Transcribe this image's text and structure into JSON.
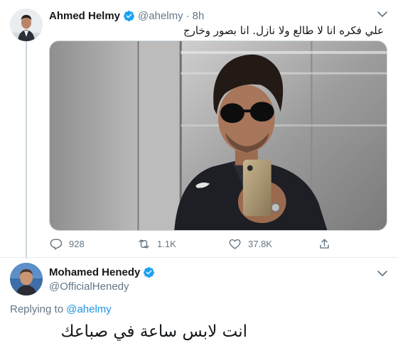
{
  "original_tweet": {
    "author": {
      "display_name": "Ahmed Helmy",
      "handle": "@ahelmy",
      "verified": true
    },
    "separator": "·",
    "time": "8h",
    "text": "علي فكره انا لا طالع ولا نازل. انا بصور وخارج",
    "media": {
      "description_icon": "elevator-selfie-photo"
    },
    "actions": {
      "reply_count": "928",
      "retweet_count": "1.1K",
      "like_count": "37.8K"
    }
  },
  "reply_tweet": {
    "author": {
      "display_name": "Mohamed Henedy",
      "handle": "@OfficialHenedy",
      "verified": true
    },
    "replying_to_label": "Replying to",
    "replying_to_handle": "@ahelmy",
    "text": "انت لابس ساعة في صباعك"
  },
  "colors": {
    "verified_blue": "#1da1f2",
    "secondary_text": "#657786",
    "link_blue": "#1b95e0",
    "thread_line": "#ccd6dd"
  }
}
